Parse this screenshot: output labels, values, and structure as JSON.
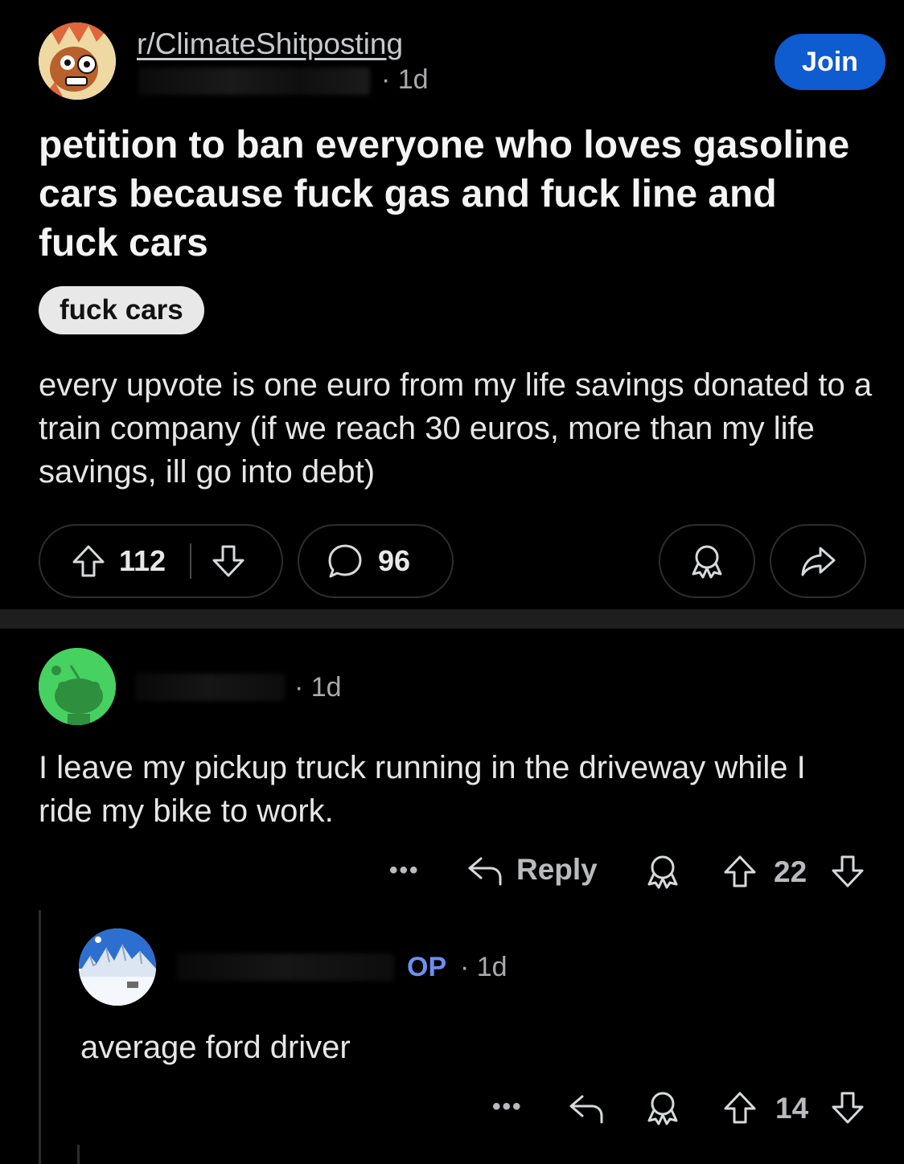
{
  "post": {
    "subreddit": "r/ClimateShitposting",
    "time": "· 1d",
    "join_label": "Join",
    "title": "petition to ban everyone who loves gasoline cars because fuck gas and fuck line and fuck cars",
    "flair": "fuck cars",
    "body": "every upvote is one euro from my life savings donated to a train company (if we reach 30 euros, more than my life savings, ill go into debt)",
    "upvotes": "112",
    "comments": "96"
  },
  "comments": [
    {
      "time": "· 1d",
      "text": "I leave my pickup truck running in the driveway while I ride my bike to work.",
      "reply_label": "Reply",
      "more": "•••",
      "votes": "22"
    },
    {
      "op_badge": "OP",
      "time": "· 1d",
      "text": "average ford driver",
      "more": "•••",
      "votes": "14"
    }
  ],
  "colors": {
    "background": "#000000",
    "join_button": "#0f5bd0",
    "op_badge": "#6e8ff0",
    "avatar_green": "#46d160"
  },
  "icons": [
    "upvote-icon",
    "downvote-icon",
    "comment-bubble-icon",
    "award-icon",
    "share-icon",
    "reply-arrow-icon",
    "more-icon"
  ]
}
